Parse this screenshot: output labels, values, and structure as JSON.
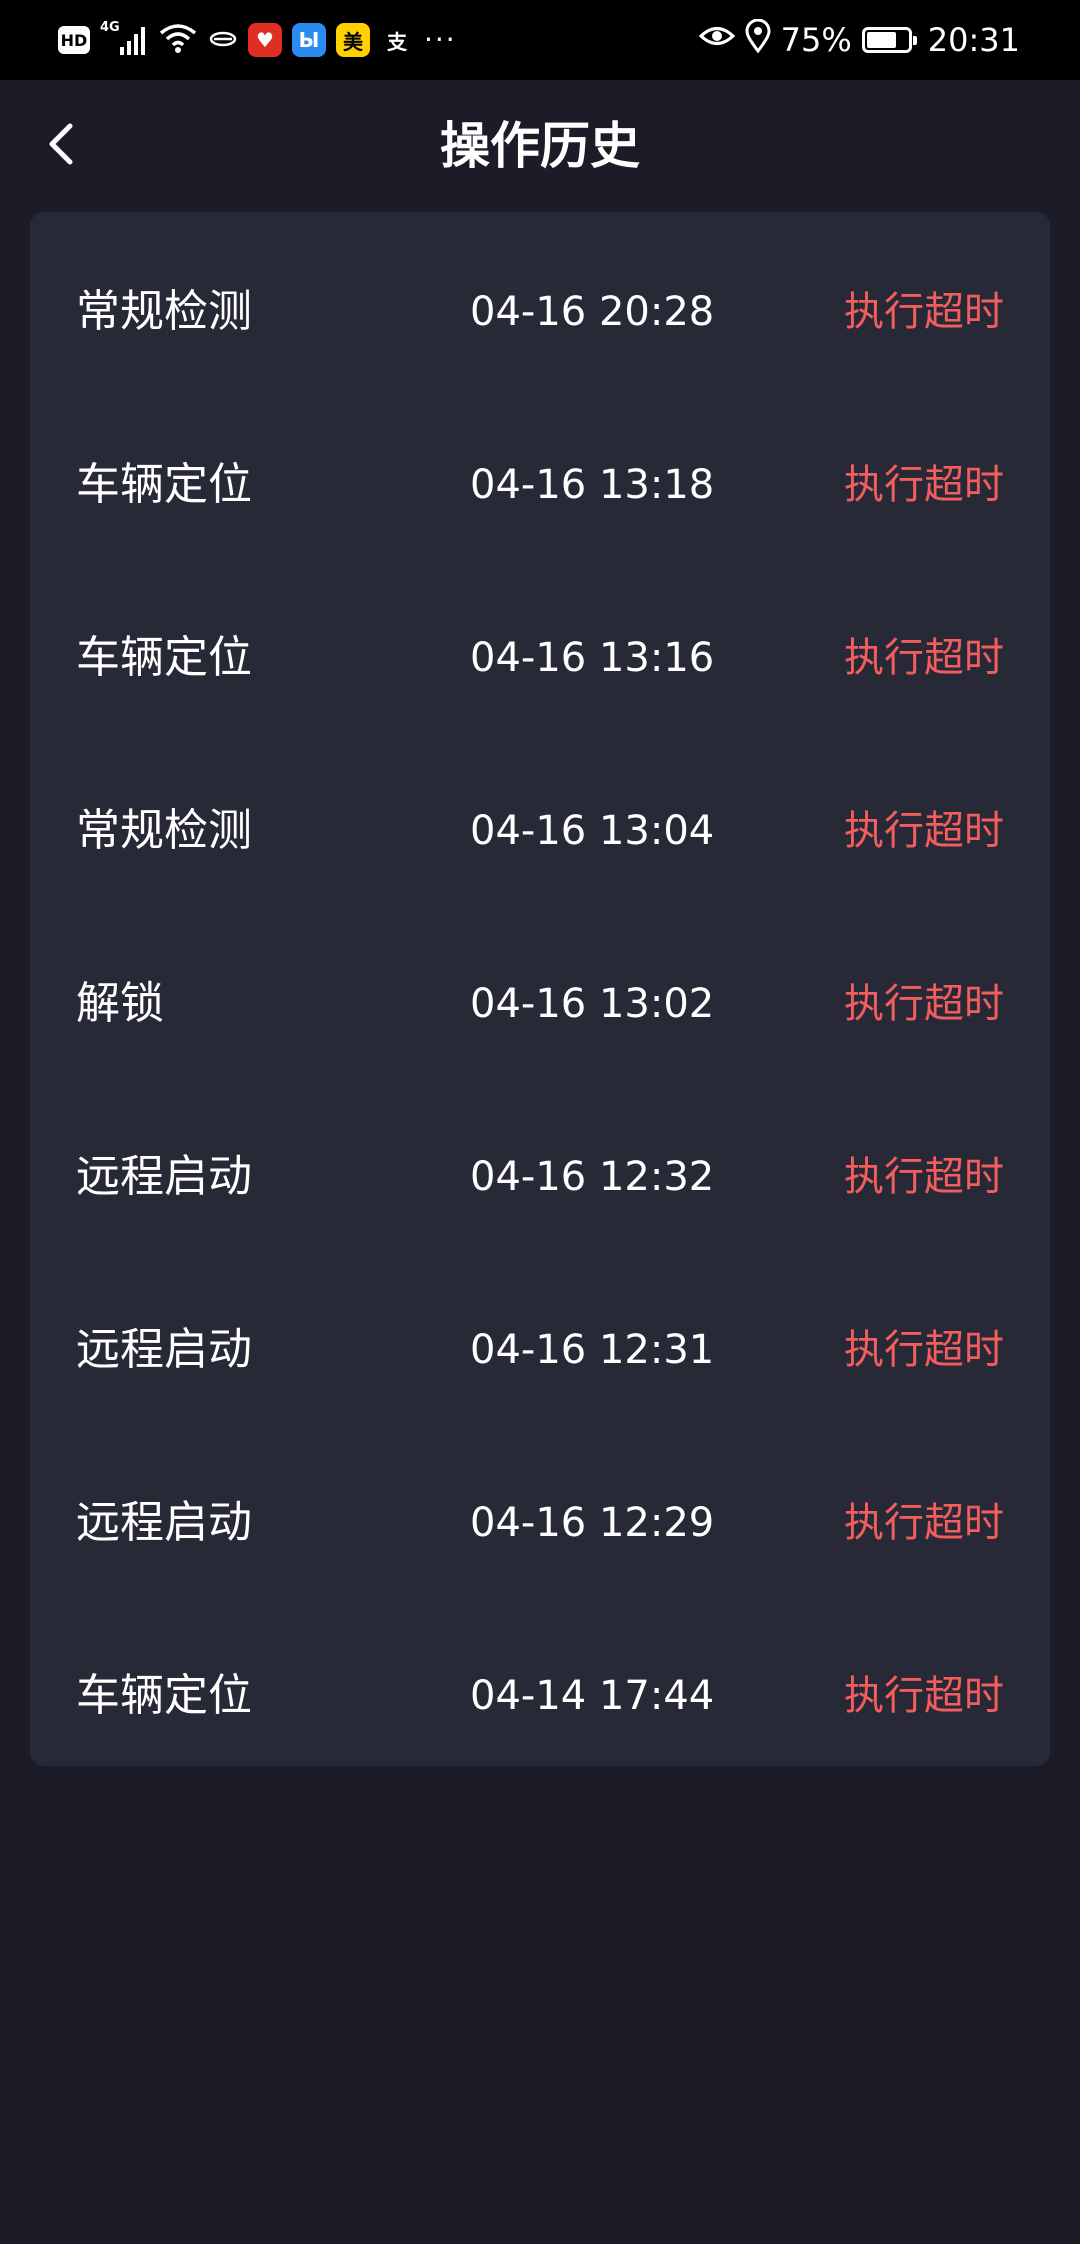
{
  "status_bar": {
    "hd_label": "HD",
    "network_label": "4G",
    "apps": [
      {
        "name": "pinduoduo-icon",
        "glyph": "♥",
        "bg": "#e02e24",
        "fg": "#ffffff"
      },
      {
        "name": "fliggy-icon",
        "glyph": "Ы",
        "bg": "#2a8cf0",
        "fg": "#ffffff"
      },
      {
        "name": "meituan-icon",
        "glyph": "美",
        "bg": "#ffd100",
        "fg": "#000000"
      },
      {
        "name": "alipay-icon",
        "glyph": "支",
        "bg": "transparent",
        "fg": "#ffffff"
      }
    ],
    "more_label": "···",
    "battery_percent": "75%",
    "battery_level": 0.75,
    "time": "20:31"
  },
  "header": {
    "title": "操作历史",
    "back_icon": "chevron-left-icon"
  },
  "colors": {
    "status_timeout": "#f25d5d",
    "card_bg": "#272937",
    "page_bg": "#1b1c27"
  },
  "history": [
    {
      "operation": "常规检测",
      "time": "04-16 20:28",
      "status": "执行超时"
    },
    {
      "operation": "车辆定位",
      "time": "04-16 13:18",
      "status": "执行超时"
    },
    {
      "operation": "车辆定位",
      "time": "04-16 13:16",
      "status": "执行超时"
    },
    {
      "operation": "常规检测",
      "time": "04-16 13:04",
      "status": "执行超时"
    },
    {
      "operation": "解锁",
      "time": "04-16 13:02",
      "status": "执行超时"
    },
    {
      "operation": "远程启动",
      "time": "04-16 12:32",
      "status": "执行超时"
    },
    {
      "operation": "远程启动",
      "time": "04-16 12:31",
      "status": "执行超时"
    },
    {
      "operation": "远程启动",
      "time": "04-16 12:29",
      "status": "执行超时"
    },
    {
      "operation": "车辆定位",
      "time": "04-14 17:44",
      "status": "执行超时"
    }
  ]
}
